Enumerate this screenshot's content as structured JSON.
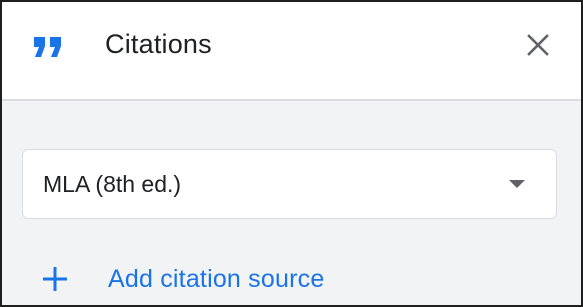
{
  "header": {
    "icon": "format-quote-icon",
    "title": "Citations",
    "close_icon": "close-icon"
  },
  "citation_style": {
    "selected": "MLA (8th ed.)",
    "dropdown_icon": "arrow-drop-down-icon"
  },
  "actions": {
    "add_source_icon": "plus-icon",
    "add_source_label": "Add citation source"
  },
  "colors": {
    "accent": "#1a73e8",
    "header_bg": "#ffffff",
    "body_bg": "#f1f3f4",
    "text": "#202124",
    "icon_gray": "#5f6368",
    "divider": "#dadce0"
  }
}
